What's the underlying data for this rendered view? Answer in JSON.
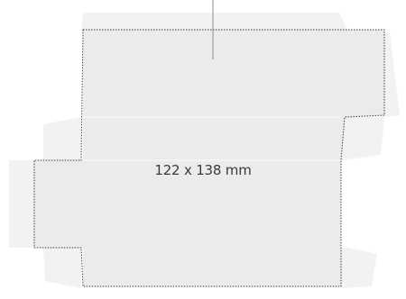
{
  "diagram": {
    "dimension_label": "122  x 138 mm",
    "colors": {
      "background": "#ffffff",
      "panel_fill": "#ebebeb",
      "flap_fill": "#f2f2f2",
      "fold_line": "#f7f7f7",
      "die_cut_dotted": "#3c3c3c",
      "pointer_line": "#8d8d8d"
    }
  }
}
